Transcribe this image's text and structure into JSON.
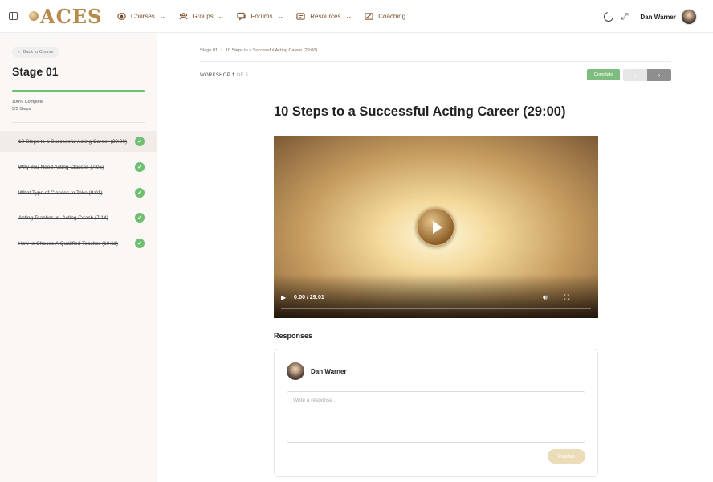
{
  "header": {
    "logo_text": "ACES",
    "nav": [
      {
        "label": "Courses",
        "icon": "courses-icon",
        "has_dropdown": true
      },
      {
        "label": "Groups",
        "icon": "groups-icon",
        "has_dropdown": true
      },
      {
        "label": "Forums",
        "icon": "forums-icon",
        "has_dropdown": true
      },
      {
        "label": "Resources",
        "icon": "resources-icon",
        "has_dropdown": true
      },
      {
        "label": "Coaching",
        "icon": "coaching-icon",
        "has_dropdown": false
      }
    ],
    "user_name": "Dan Warner"
  },
  "sidebar": {
    "back_label": "Back to Course",
    "stage_title": "Stage 01",
    "progress_percent": 100,
    "progress_label": "100% Complete",
    "steps_label": "5/5 Steps",
    "lessons": [
      {
        "title": "10 Steps to a Successful Acting Career (29:00)",
        "completed": true,
        "active": true
      },
      {
        "title": "Why You Need Acting Classes (7:05)",
        "completed": true,
        "active": false
      },
      {
        "title": "What Type of Classes to Take (9:01)",
        "completed": true,
        "active": false
      },
      {
        "title": "Acting Teacher vs. Acting Coach (7:14)",
        "completed": true,
        "active": false
      },
      {
        "title": "How to Choose A Qualified Teacher (10:11)",
        "completed": true,
        "active": false
      }
    ]
  },
  "main": {
    "breadcrumb": [
      "Stage 01",
      "10 Steps to a Successful Acting Career (29:00)"
    ],
    "breadcrumb_sep": "›",
    "workshop_label": "WORKSHOP",
    "workshop_current": "1",
    "workshop_of": "OF 5",
    "complete_label": "Complete",
    "prev_label": "‹",
    "next_label": "›",
    "lesson_title": "10 Steps to a Successful Acting Career (29:00)",
    "video": {
      "time": "0:00 / 29:01",
      "progress": 0
    },
    "responses": {
      "heading": "Responses",
      "author": "Dan Warner",
      "placeholder": "Write a response...",
      "publish_label": "Publish"
    }
  },
  "colors": {
    "accent_brown": "#7a4a23",
    "logo_gold": "#b58a4c",
    "success_green": "#6fbf73",
    "publish_beige": "#ecdcb7"
  }
}
